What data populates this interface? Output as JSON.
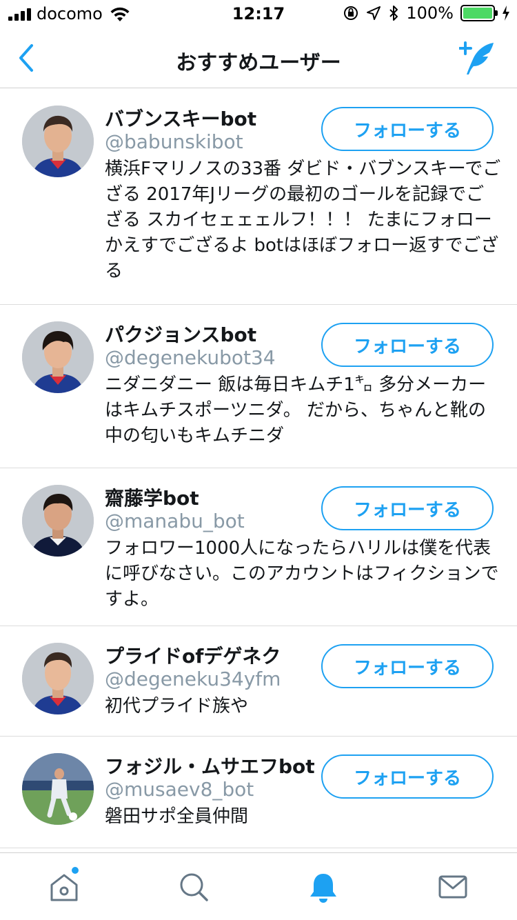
{
  "status_bar": {
    "carrier": "docomo",
    "time": "12:17",
    "battery": "100%"
  },
  "nav": {
    "title": "おすすめユーザー",
    "back_icon": "chevron-left-icon",
    "compose_icon": "compose-tweet-icon"
  },
  "follow_label": "フォローする",
  "users": [
    {
      "name": "バブンスキーbot",
      "handle": "@babunskibot",
      "bio": "横浜Fマリノスの33番 ダビド・バブンスキーでござる 2017年Jリーグの最初のゴールを記録でござる スカイセェェェルフ！！！ たまにフォローかえすでござるよ botはほぼフォロー返すでござる"
    },
    {
      "name": "パクジョンスbot",
      "handle": "@degenekubot34",
      "bio": "ニダニダニー 飯は毎日キムチ1㌔ 多分メーカーはキムチスポーツニダ。 だから、ちゃんと靴の中の匂いもキムチニダ"
    },
    {
      "name": "齋藤学bot",
      "handle": "@manabu_bot",
      "bio": "フォロワー1000人になったらハリルは僕を代表に呼びなさい。このアカウントはフィクションですよ。"
    },
    {
      "name": "プライドofデゲネク",
      "handle": "@degeneku34yfm",
      "bio": "初代プライド族や"
    },
    {
      "name": "フォジル・ムサエフbot",
      "handle": "@musaev8_bot",
      "bio": "磐田サポ全員仲間"
    }
  ],
  "tabs": [
    {
      "icon": "home-icon",
      "active": false,
      "badge": true
    },
    {
      "icon": "search-icon",
      "active": false,
      "badge": false
    },
    {
      "icon": "notifications-bell-icon",
      "active": true,
      "badge": false
    },
    {
      "icon": "messages-envelope-icon",
      "active": false,
      "badge": false
    }
  ],
  "colors": {
    "accent": "#1da1f2",
    "handle": "#8899a6",
    "inactive_icon": "#657786",
    "battery": "#4cd964"
  }
}
